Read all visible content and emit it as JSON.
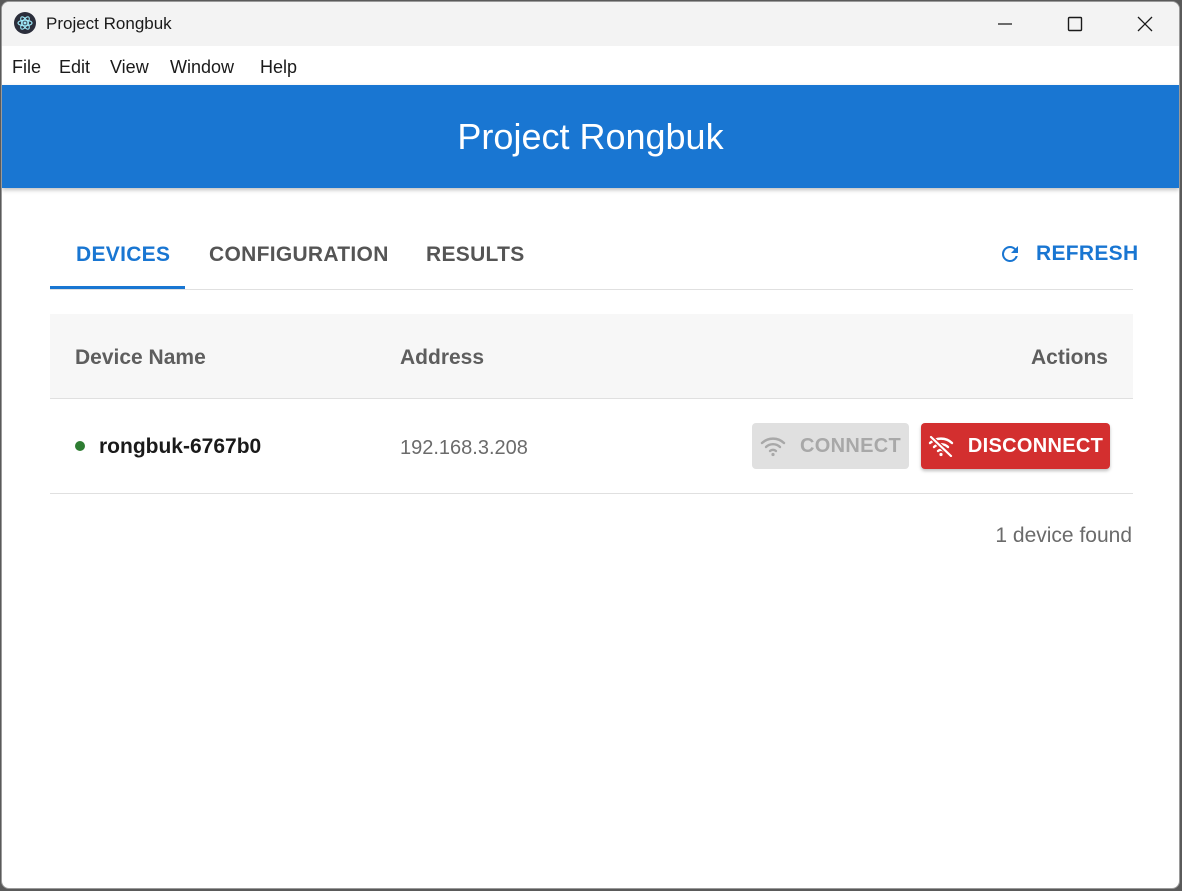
{
  "window": {
    "title": "Project Rongbuk"
  },
  "menu": {
    "items": [
      "File",
      "Edit",
      "View",
      "Window",
      "Help"
    ]
  },
  "header": {
    "title": "Project Rongbuk",
    "color": "#1976d2"
  },
  "tabs": [
    {
      "label": "DEVICES",
      "active": true
    },
    {
      "label": "CONFIGURATION",
      "active": false
    },
    {
      "label": "RESULTS",
      "active": false
    }
  ],
  "refresh": {
    "label": "REFRESH",
    "icon": "refresh-icon"
  },
  "table": {
    "columns": [
      "Device Name",
      "Address",
      "Actions"
    ],
    "rows": [
      {
        "status": "online",
        "status_color": "#2e7d32",
        "name": "rongbuk-6767b0",
        "address": "192.168.3.208",
        "connect_label": "CONNECT",
        "connect_icon": "wifi-icon",
        "connect_disabled": true,
        "disconnect_label": "DISCONNECT",
        "disconnect_icon": "wifi-off-icon",
        "disconnect_color": "#d32f2f"
      }
    ]
  },
  "footer": {
    "count_text": "1 device found"
  }
}
